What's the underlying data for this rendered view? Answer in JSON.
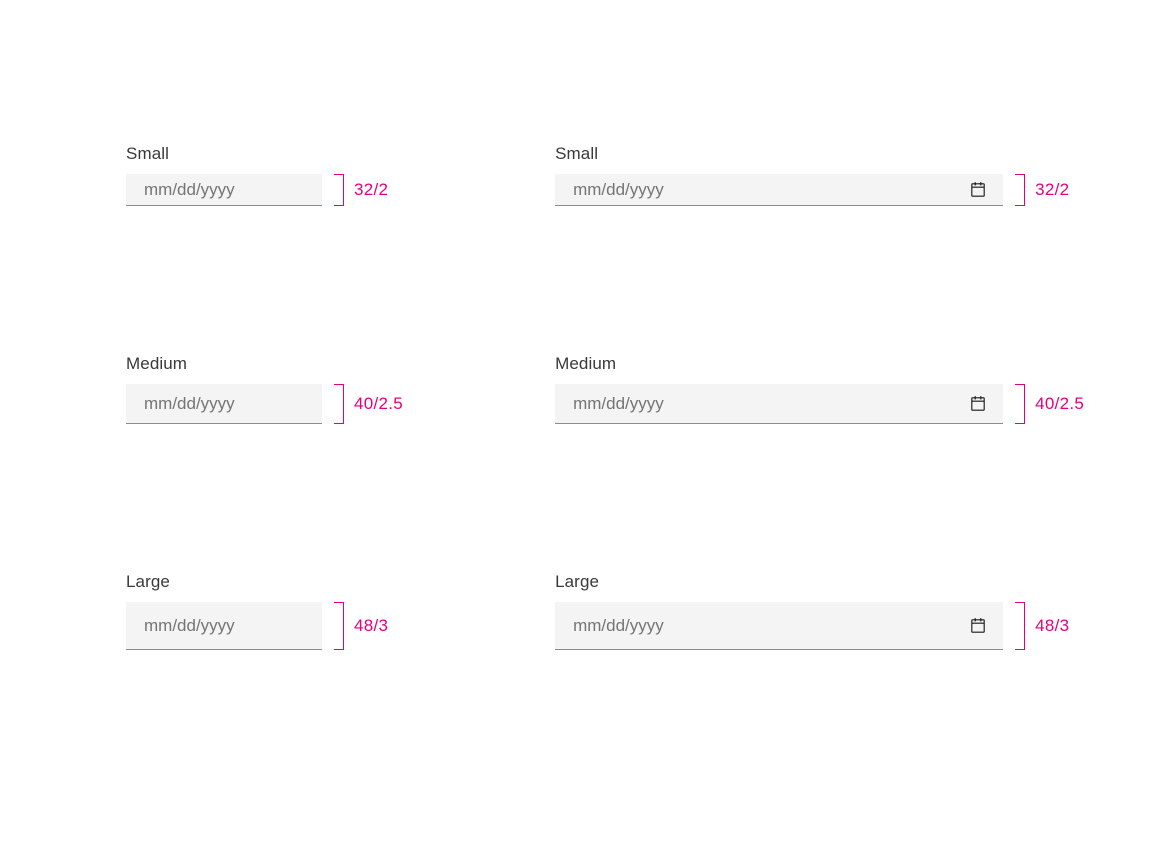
{
  "labels": {
    "small": "Small",
    "medium": "Medium",
    "large": "Large"
  },
  "placeholder": "mm/dd/yyyy",
  "dimensions": {
    "small": "32/2",
    "medium": "40/2.5",
    "large": "48/3"
  },
  "colors": {
    "accent": "#e6007e",
    "field_bg": "#f4f4f4",
    "field_border": "#8d8d8d",
    "label_color": "#393939",
    "placeholder_color": "#757575"
  }
}
